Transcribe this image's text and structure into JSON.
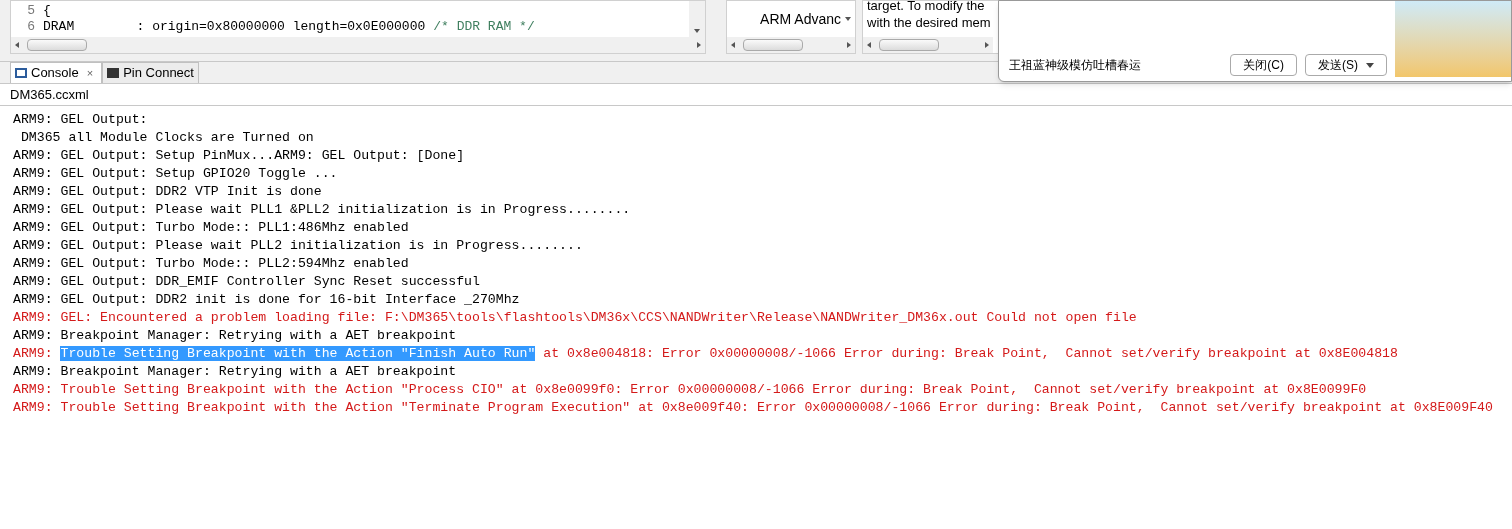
{
  "editor": {
    "lines": [
      {
        "number": "5",
        "code": "{"
      },
      {
        "number": "6",
        "code": "DRAM        : origin=0x80000000 length=0x0E000000",
        "comment": "/* DDR RAM */"
      }
    ]
  },
  "middle_panel": {
    "text": "ARM Advanc"
  },
  "right_panel": {
    "lines": [
      "target.  To modify the",
      "with the desired mem"
    ]
  },
  "notification": {
    "headline": "王祖蓝神级模仿吐槽春运",
    "buttons": [
      "关闭(C)",
      "发送(S)"
    ]
  },
  "tabs": [
    {
      "label": "Console",
      "selected": true,
      "close": "×"
    },
    {
      "label": "Pin Connect",
      "selected": false
    }
  ],
  "console": {
    "title": "DM365.ccxml",
    "lines": [
      {
        "kind": "output",
        "parts": [
          {
            "text": "ARM9: GEL Output: ",
            "selected": false
          }
        ]
      },
      {
        "kind": "output",
        "parts": [
          {
            "text": " DM365 all Module Clocks are Turned on",
            "selected": false
          }
        ]
      },
      {
        "kind": "output",
        "parts": [
          {
            "text": "ARM9: GEL Output: Setup PinMux...ARM9: GEL Output: [Done]",
            "selected": false
          }
        ]
      },
      {
        "kind": "output",
        "parts": [
          {
            "text": "ARM9: GEL Output: Setup GPIO20 Toggle ...",
            "selected": false
          }
        ]
      },
      {
        "kind": "output",
        "parts": [
          {
            "text": "ARM9: GEL Output: DDR2 VTP Init is done",
            "selected": false
          }
        ]
      },
      {
        "kind": "output",
        "parts": [
          {
            "text": "ARM9: GEL Output: Please wait PLL1 &PLL2 initialization is in Progress........",
            "selected": false
          }
        ]
      },
      {
        "kind": "output",
        "parts": [
          {
            "text": "ARM9: GEL Output: Turbo Mode:: PLL1:486Mhz enabled",
            "selected": false
          }
        ]
      },
      {
        "kind": "output",
        "parts": [
          {
            "text": "ARM9: GEL Output: Please wait PLL2 initialization is in Progress........",
            "selected": false
          }
        ]
      },
      {
        "kind": "output",
        "parts": [
          {
            "text": "ARM9: GEL Output: Turbo Mode:: PLL2:594Mhz enabled",
            "selected": false
          }
        ]
      },
      {
        "kind": "output",
        "parts": [
          {
            "text": "ARM9: GEL Output: DDR_EMIF Controller Sync Reset successful",
            "selected": false
          }
        ]
      },
      {
        "kind": "output",
        "parts": [
          {
            "text": "ARM9: GEL Output: DDR2 init is done for 16-bit Interface _270Mhz",
            "selected": false
          }
        ]
      },
      {
        "kind": "error",
        "parts": [
          {
            "text": "ARM9: GEL: Encountered a problem loading file: F:\\DM365\\tools\\flashtools\\DM36x\\CCS\\NANDWriter\\Release\\NANDWriter_DM36x.out Could not open file",
            "selected": false
          }
        ]
      },
      {
        "kind": "output",
        "parts": [
          {
            "text": "ARM9: Breakpoint Manager: Retrying with a AET breakpoint",
            "selected": false
          }
        ]
      },
      {
        "kind": "error",
        "parts": [
          {
            "text": "ARM9: ",
            "selected": false
          },
          {
            "text": "Trouble Setting Breakpoint with the Action \"Finish Auto Run\"",
            "selected": true
          },
          {
            "text": " at 0x8e004818: Error 0x00000008/-1066 Error during: Break Point,  Cannot set/verify breakpoint at 0x8E004818",
            "selected": false
          }
        ]
      },
      {
        "kind": "output",
        "parts": [
          {
            "text": "ARM9: Breakpoint Manager: Retrying with a AET breakpoint",
            "selected": false
          }
        ]
      },
      {
        "kind": "error",
        "parts": [
          {
            "text": "ARM9: Trouble Setting Breakpoint with the Action \"Process CIO\" at 0x8e0099f0: Error 0x00000008/-1066 Error during: Break Point,  Cannot set/verify breakpoint at 0x8E0099F0",
            "selected": false
          }
        ]
      },
      {
        "kind": "error",
        "parts": [
          {
            "text": "ARM9: Trouble Setting Breakpoint with the Action \"Terminate Program Execution\" at 0x8e009f40: Error 0x00000008/-1066 Error during: Break Point,  Cannot set/verify breakpoint at 0x8E009F40",
            "selected": false
          }
        ]
      }
    ]
  }
}
